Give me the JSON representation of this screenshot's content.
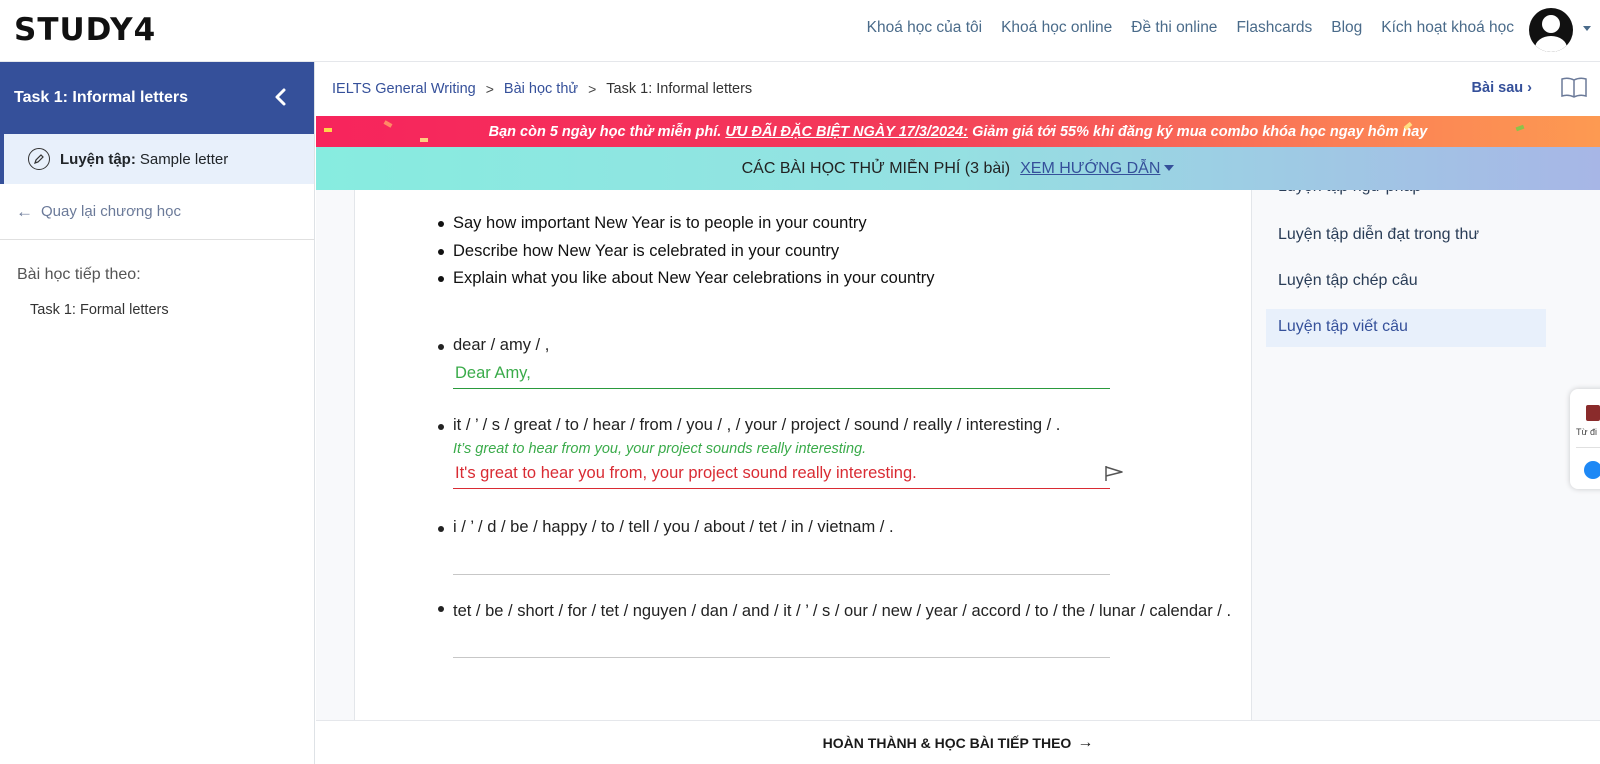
{
  "header": {
    "logo": "STUDY4",
    "nav": [
      "Khoá học của tôi",
      "Khoá học online",
      "Đề thi online",
      "Flashcards",
      "Blog",
      "Kích hoạt khoá học"
    ]
  },
  "sidebar": {
    "title": "Task 1: Informal letters",
    "active_item": {
      "prefix": "Luyện tập:",
      "label": "Sample letter"
    },
    "back_link": "Quay lại chương học",
    "next_title": "Bài học tiếp theo:",
    "next_item": "Task 1: Formal letters"
  },
  "breadcrumb": {
    "items": [
      "IELTS General Writing",
      "Bài học thử",
      "Task 1: Informal letters"
    ],
    "next_lesson": "Bài sau"
  },
  "promo": {
    "lead": "Bạn còn 5 ngày học thử miễn phí.",
    "highlight": "ƯU ĐÃI ĐẶC BIỆT NGÀY 17/3/2024:",
    "tail": "Giảm giá tới 55% khi đăng ký mua combo khóa học ngay hôm nay"
  },
  "free_bar": {
    "text": "CÁC BÀI HỌC THỬ MIỄN PHÍ (3 bài)",
    "guide": "XEM HƯỚNG DẪN"
  },
  "task_bullets": [
    "Say how important New Year is to people in your country",
    "Describe how New Year is celebrated in your country",
    "Explain what you like about New Year celebrations in your country"
  ],
  "questions": [
    {
      "prompt": "dear / amy / ,",
      "hint": "",
      "answer": "Dear Amy,",
      "status": "correct"
    },
    {
      "prompt": "it / ’ / s / great / to / hear / from / you / , / your / project / sound / really / interesting / .",
      "hint": "It’s great to hear from you, your project sounds really interesting.",
      "answer": "It's great to hear you from, your project sound really interesting.",
      "status": "wrong"
    },
    {
      "prompt": "i / ’ / d / be / happy / to / tell / you / about / tet / in / vietnam / .",
      "hint": "",
      "answer": "",
      "status": "empty"
    },
    {
      "prompt": "tet / be / short / for / tet / nguyen / dan / and / it / ’ / s / our / new / year / accord / to / the / lunar / calendar / .",
      "hint": "",
      "answer": "",
      "status": "empty"
    }
  ],
  "toc": {
    "items": [
      "Luyện tập ngữ pháp",
      "Luyện tập diễn đạt trong thư",
      "Luyện tập chép câu",
      "Luyện tập viết câu"
    ],
    "active_index": 3
  },
  "floater": {
    "dict_label": "Từ đi"
  },
  "footer": {
    "complete_label": "HOÀN THÀNH & HỌC BÀI TIẾP THEO"
  },
  "colors": {
    "primary": "#35509a",
    "correct": "#3aab4a",
    "wrong": "#d92b33"
  }
}
